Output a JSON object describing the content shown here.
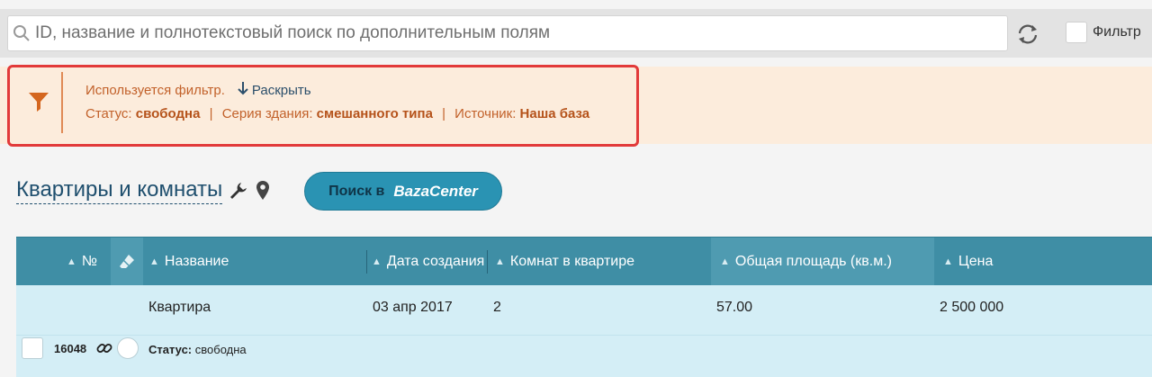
{
  "search": {
    "placeholder": "ID, название и полнотекстовый поиск по дополнительным полям"
  },
  "toolbar": {
    "filter_label": "Фильтр"
  },
  "filter": {
    "notice": "Используется фильтр.",
    "expand_label": "Раскрыть",
    "criteria": [
      {
        "label": "Статус:",
        "value": "свободна"
      },
      {
        "label": "Серия здания:",
        "value": "смешанного типа"
      },
      {
        "label": "Источник:",
        "value": "Наша база"
      }
    ],
    "separator": "|"
  },
  "page": {
    "title": "Квартиры и комнаты",
    "search_button_prefix": "Поиск в",
    "search_button_brand": "BazaCenter"
  },
  "table": {
    "columns": [
      "№",
      "Название",
      "Дата создания",
      "Комнат в квартире",
      "Общая площадь (кв.м.)",
      "Цена"
    ],
    "rows": [
      {
        "name": "Квартира",
        "date": "03 апр 2017",
        "rooms": "2",
        "area": "57.00",
        "price": "2 500 000",
        "id": "16048",
        "status_label": "Статус:",
        "status_value": "свободна"
      }
    ]
  },
  "colors": {
    "accent": "#3f8ea5",
    "filter_bg": "#fcecdc",
    "filter_text": "#c2612a",
    "highlight_border": "#e23a3a",
    "row_bg": "#d4eef6"
  },
  "icons": [
    "search-icon",
    "refresh-icon",
    "funnel-icon",
    "arrow-down-icon",
    "wrench-icon",
    "location-pin-icon",
    "eraser-icon",
    "link-icon"
  ]
}
